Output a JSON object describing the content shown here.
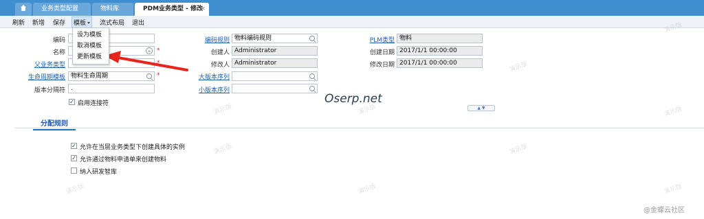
{
  "tabs": [
    {
      "label": "业务类型配置"
    },
    {
      "label": "物料库"
    },
    {
      "label": "PDM业务类型 - 修改",
      "close": "×"
    }
  ],
  "toolbar": {
    "refresh": "刷新",
    "new": "新增",
    "save": "保存",
    "template": "模板",
    "flow_layout": "流式布局",
    "exit": "退出"
  },
  "template_menu": [
    "设为模板",
    "取消模板",
    "更新模板"
  ],
  "form": {
    "code_label": "编码",
    "name_label": "名称",
    "parent_type_label": "父业务类型",
    "lifecycle_label": "生命周期模板",
    "lifecycle_value": "物料生命周期",
    "version_sep_label": "版本分隔符",
    "version_sep_value": ".",
    "enable_connector_label": "启用连接符",
    "code_rule_label": "编码规则",
    "code_rule_value": "物料编码规则",
    "creator_label": "创建人",
    "creator_value": "Administrator",
    "modifier_label": "修改人",
    "modifier_value": "Administrator",
    "major_seq_label": "大版本序列",
    "minor_seq_label": "小版本序列",
    "plm_type_label": "PLM类型",
    "plm_type_value": "物料",
    "create_date_label": "创建日期",
    "create_date_value": "2017/1/1 00:00:00",
    "modify_date_label": "修改日期",
    "modify_date_value": "2017/1/1 00:00:00"
  },
  "brand_text": "Oserp.net",
  "section_tab": "分配规则",
  "rules": [
    {
      "label": "允许在当层业务类型下创建具体的实例",
      "checked": true
    },
    {
      "label": "允许通过物料申请单来创建物料",
      "checked": true
    },
    {
      "label": "纳入研发智库",
      "checked": false
    }
  ],
  "watermark": "演示版",
  "credit": "@金蝶云社区",
  "colors": {
    "tab_bar": "#3f8fd0",
    "link": "#1a5fb4",
    "required": "#e02020",
    "arrow": "#e8231b"
  }
}
